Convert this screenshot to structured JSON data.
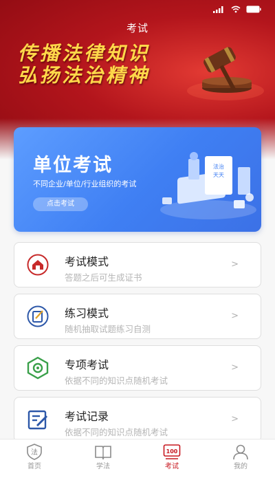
{
  "header": {
    "title": "考试",
    "slogan_line1": "传播法律知识",
    "slogan_line2": "弘扬法治精神"
  },
  "banner": {
    "title": "单位考试",
    "subtitle": "不同企业/单位/行业组织的考试",
    "button_label": "点击考试",
    "illustration_text": "法治天天"
  },
  "modes": [
    {
      "title": "考试模式",
      "desc": "答题之后可生成证书",
      "arrow": ">",
      "icon": "house-certificate-icon"
    },
    {
      "title": "练习模式",
      "desc": "随机抽取试题练习自测",
      "arrow": ">",
      "icon": "practice-edit-icon"
    },
    {
      "title": "专项考试",
      "desc": "依据不同的知识点随机考试",
      "arrow": ">",
      "icon": "target-icon"
    },
    {
      "title": "考试记录",
      "desc": "依据不同的知识点随机考试",
      "arrow": ">",
      "icon": "record-edit-icon"
    }
  ],
  "tabbar": {
    "items": [
      {
        "label": "首页",
        "icon_text": "法"
      },
      {
        "label": "学法"
      },
      {
        "label": "考试",
        "icon_text": "100"
      },
      {
        "label": "我的"
      }
    ],
    "active_index": 2,
    "active_color": "#c7161e"
  },
  "colors": {
    "header_red": "#b3151c",
    "slogan_gold": "#ffd84a",
    "banner_blue": "#3f7ff3"
  }
}
